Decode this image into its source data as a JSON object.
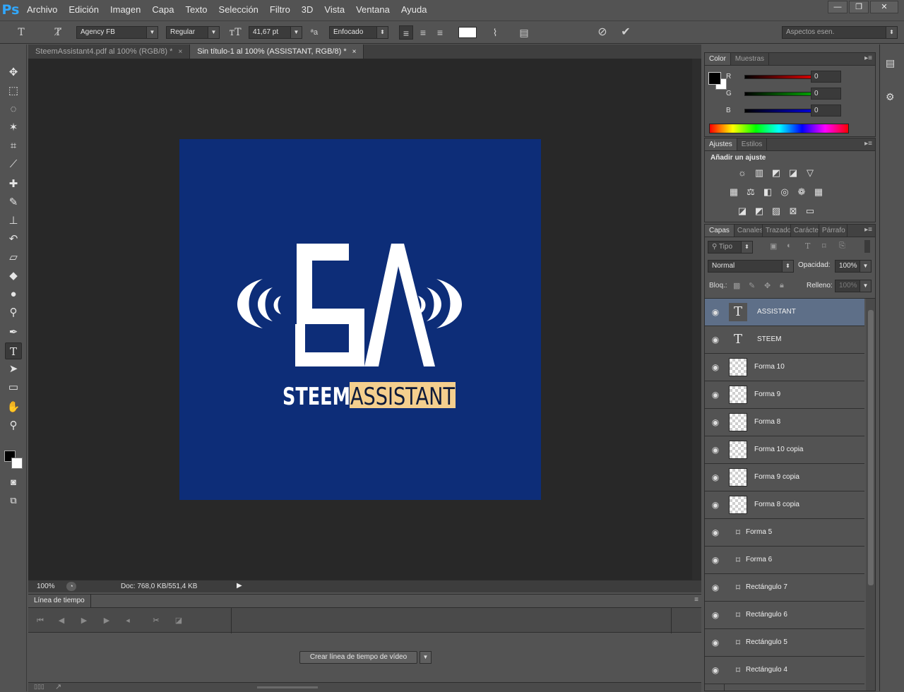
{
  "app": {
    "logo": "Ps"
  },
  "menu": [
    "Archivo",
    "Edición",
    "Imagen",
    "Capa",
    "Texto",
    "Selección",
    "Filtro",
    "3D",
    "Vista",
    "Ventana",
    "Ayuda"
  ],
  "window_controls": {
    "minimize": "—",
    "restore": "❐",
    "close": "✕"
  },
  "options": {
    "font_family": "Agency FB",
    "font_style": "Regular",
    "font_size": "41,67 pt",
    "aa_icon_label": "ªa",
    "antialias": "Enfocado",
    "workspace": "Aspectos esen."
  },
  "tabs": [
    {
      "label": "SteemAssistant4.pdf al 100% (RGB/8) *",
      "close": "×",
      "active": false
    },
    {
      "label": "Sin título-1 al 100% (ASSISTANT, RGB/8) *",
      "close": "×",
      "active": true
    }
  ],
  "artwork": {
    "monogram_left": "S",
    "monogram_right": "A",
    "text_steem": "STEEM",
    "text_assistant": "ASSISTANT",
    "background_color": "#0d2d78",
    "highlight_color": "#f4cf8e"
  },
  "status": {
    "zoom": "100%",
    "doc": "Doc: 768,0 KB/551,4 KB"
  },
  "timeline": {
    "tab": "Línea de tiempo",
    "create_button": "Crear línea de tiempo de vídeo"
  },
  "color_panel": {
    "tabs": [
      "Color",
      "Muestras"
    ],
    "channels": [
      {
        "label": "R",
        "value": "0",
        "color": "#ff0000"
      },
      {
        "label": "G",
        "value": "0",
        "color": "#00c000"
      },
      {
        "label": "B",
        "value": "0",
        "color": "#0000ff"
      }
    ]
  },
  "adjust_panel": {
    "tabs": [
      "Ajustes",
      "Estilos"
    ],
    "title": "Añadir un ajuste"
  },
  "layers_panel": {
    "tabs": [
      "Capas",
      "Canales",
      "Trazados",
      "Carácter",
      "Párrafo"
    ],
    "filter_kind": "Tipo",
    "blend_mode": "Normal",
    "opacity_label": "Opacidad:",
    "opacity": "100%",
    "lock_label": "Bloq.:",
    "fill_label": "Relleno:",
    "fill": "100%",
    "layers": [
      {
        "name": "ASSISTANT",
        "kind": "type",
        "selected": true
      },
      {
        "name": "STEEM",
        "kind": "type",
        "selected": false
      },
      {
        "name": "Forma 10",
        "kind": "raster",
        "selected": false
      },
      {
        "name": "Forma 9",
        "kind": "raster",
        "selected": false
      },
      {
        "name": "Forma 8",
        "kind": "raster",
        "selected": false
      },
      {
        "name": "Forma 10 copia",
        "kind": "raster",
        "selected": false
      },
      {
        "name": "Forma 9 copia",
        "kind": "raster",
        "selected": false
      },
      {
        "name": "Forma 8 copia",
        "kind": "raster",
        "selected": false
      },
      {
        "name": "Forma 5",
        "kind": "shape",
        "selected": false
      },
      {
        "name": "Forma 6",
        "kind": "shape",
        "selected": false
      },
      {
        "name": "Rectángulo 7",
        "kind": "shape",
        "selected": false
      },
      {
        "name": "Rectángulo 6",
        "kind": "shape",
        "selected": false
      },
      {
        "name": "Rectángulo 5",
        "kind": "shape",
        "selected": false
      },
      {
        "name": "Rectángulo 4",
        "kind": "shape",
        "selected": false
      }
    ]
  }
}
